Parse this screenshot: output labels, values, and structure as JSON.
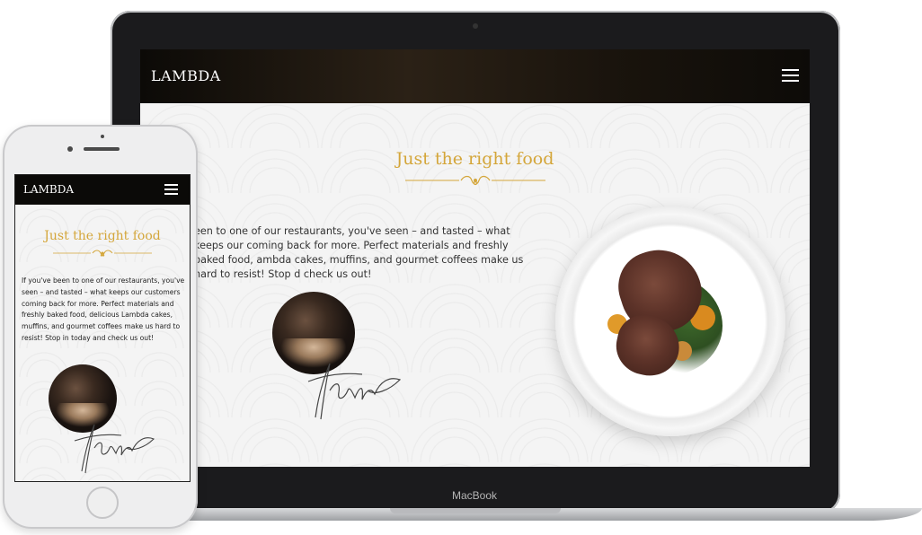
{
  "laptop": {
    "brand": "LAMBDA",
    "heading": "Just the right food",
    "paragraph": "een to one of our restaurants, you've seen – and tasted – what keeps our coming back for more. Perfect materials and freshly baked food, ambda cakes, muffins, and gourmet coffees make us hard to resist! Stop d check us out!",
    "device_label": "MacBook",
    "menu_icon": "hamburger-menu-icon"
  },
  "phone": {
    "brand": "LAMBDA",
    "heading": "Just the right food",
    "paragraph": "If you've been to one of our restaurants, you've seen – and tasted – what keeps our customers coming back for more. Perfect materials and freshly baked food, delicious Lambda cakes, muffins, and gourmet coffees make us hard to resist! Stop in today and check us out!",
    "menu_icon": "hamburger-menu-icon"
  },
  "colors": {
    "accent_gold": "#d4a63a",
    "nav_dark": "#0b0a08"
  }
}
